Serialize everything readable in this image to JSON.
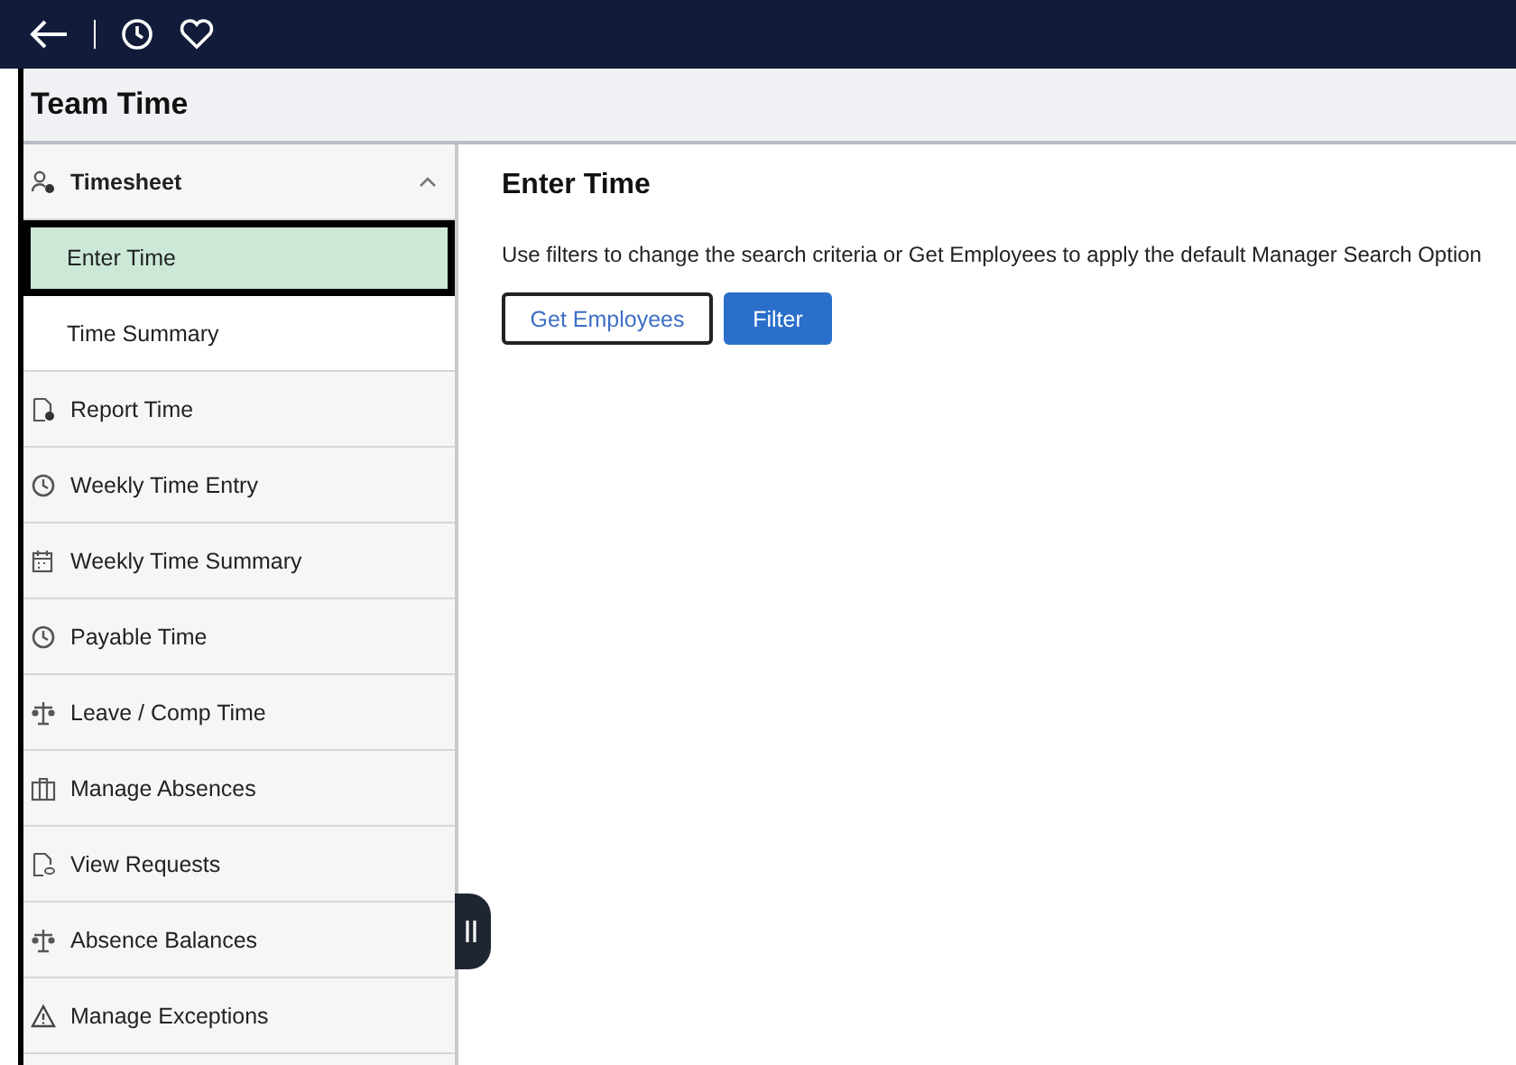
{
  "header": {
    "title": "Team Time"
  },
  "sidebar": {
    "items": [
      {
        "label": "Timesheet",
        "kind": "group",
        "expanded": true,
        "children": [
          {
            "label": "Enter Time",
            "selected": true
          },
          {
            "label": "Time Summary",
            "selected": false
          }
        ]
      },
      {
        "label": "Report Time",
        "kind": "link"
      },
      {
        "label": "Weekly Time Entry",
        "kind": "link"
      },
      {
        "label": "Weekly Time Summary",
        "kind": "link"
      },
      {
        "label": "Payable Time",
        "kind": "link"
      },
      {
        "label": "Leave / Comp Time",
        "kind": "link"
      },
      {
        "label": "Manage Absences",
        "kind": "link"
      },
      {
        "label": "View Requests",
        "kind": "link"
      },
      {
        "label": "Absence Balances",
        "kind": "link"
      },
      {
        "label": "Manage Exceptions",
        "kind": "link"
      }
    ]
  },
  "main": {
    "title": "Enter Time",
    "description": "Use filters to change the search criteria or Get Employees to apply the default Manager Search Option",
    "buttons": [
      {
        "label": "Get Employees",
        "kind": "secondary"
      },
      {
        "label": "Filter",
        "kind": "primary"
      }
    ]
  }
}
